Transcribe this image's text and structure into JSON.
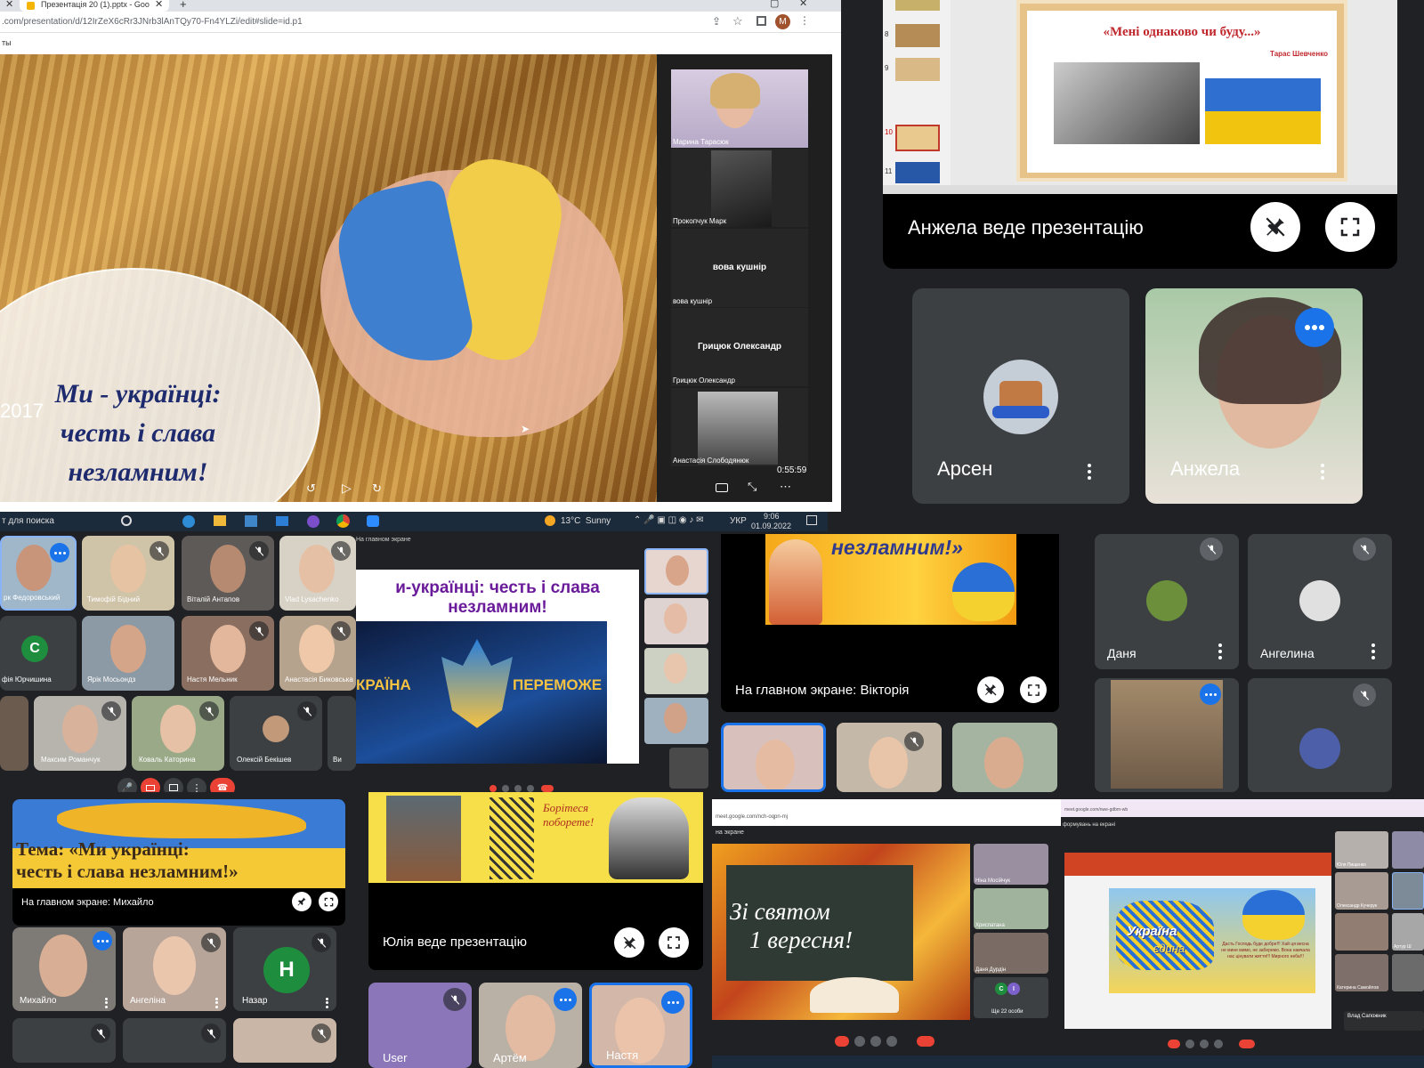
{
  "browser": {
    "tab_title": "Презентація 20 (1).pptx - Goo",
    "url": ".com/presentation/d/12IrZeX6cRr3JNrb3lAnTQy70-Fn4YLZi/edit#slide=id.p1",
    "bookmark": "ты",
    "profile_initial": "M"
  },
  "slide_main": {
    "title_line1": "Ми - українці:",
    "title_line2": "честь і слава",
    "title_line3": "незламним!",
    "year": "2017",
    "video_time": "0:55:59"
  },
  "side_participants": [
    {
      "name": "Марина Тарасюк"
    },
    {
      "name": "Прокопчук Марк"
    },
    {
      "name": "вова кушнір",
      "center": "вова кушнір"
    },
    {
      "name": "Грицюк Олександр",
      "center": "Грицюк Олександр"
    },
    {
      "name": "Анастасія Слободянюк"
    }
  ],
  "taskbar": {
    "search": "т для поиска",
    "weather": "13°C  Sunny",
    "lang": "УКР",
    "time": "9:06",
    "date": "01.09.2022"
  },
  "top_right": {
    "slide_title": "«Мені однаково чи буду...»",
    "slide_author": "Тарас Шевченко",
    "slide_numbers": [
      "8",
      "9",
      "10",
      "11"
    ],
    "presenting": "Анжела веде презентацію",
    "participants": [
      {
        "name": "Арсен"
      },
      {
        "name": "Анжела"
      }
    ]
  },
  "grid_mid_left": {
    "participants": [
      "рк Федоровський",
      "Тимофій Бідний",
      "Віталій Антапов",
      "Vlad Lysachenko",
      "фія Юрчишина",
      "Ярік Мосьондз",
      "Настя Мельник",
      "Анастасія Биковська",
      "Максим Романчук",
      "Коваль Каторина",
      "Олексій Бекішев",
      "Ви"
    ],
    "avatar_letter": "C"
  },
  "slide_center": {
    "title_line1": "и-українці: честь і слава",
    "title_line2": "незламним!",
    "banner_left": "КРАЇНА",
    "banner_right": "ПЕРЕМОЖЕ",
    "header": "На главном экране"
  },
  "mid_right": {
    "slide_text": "незламним!»",
    "main_screen": "На главном экране: Вікторія",
    "participants": [
      {
        "name": "Даня"
      },
      {
        "name": "Ангелина"
      }
    ]
  },
  "bottom_left": {
    "slide_title_line1": "Тема: «Ми українці:",
    "slide_title_line2": "честь і слава незламним!»",
    "main_screen": "На главном экране: Михайло",
    "participants": [
      {
        "name": "Михайло"
      },
      {
        "name": "Ангеліна"
      },
      {
        "name": "Назар",
        "letter": "Н"
      }
    ]
  },
  "bottom_center": {
    "slide_text": "Борітеся поборете!",
    "presenting": "Юлія веде презентацію",
    "participants": [
      {
        "name": "User"
      },
      {
        "name": "Артём"
      },
      {
        "name": "Настя"
      }
    ]
  },
  "bottom_right_a": {
    "url": "meet.google.com/nch-oqpn-mj",
    "header": "на экране",
    "slide_line1": "Зі святом",
    "slide_line2": "1 вересня!",
    "more": "Ще 22 особи",
    "side_names": [
      "Ніна Мосійчук",
      "Хриспатана",
      "Даня Дурдін"
    ]
  },
  "bottom_right_b": {
    "url": "meet.google.com/nwe-gdbm-wb",
    "header": "формувань на екрані",
    "slide_word1": "Україна",
    "slide_word2": "єдина",
    "slide_poem": "Дасть Господь буде добре!!! Хай ця весна не мине мимо, не заберемо. Вона навчала нас цінувати життя!!! Мирного неба!!!",
    "notification": "Влад Сапожник",
    "side_names": [
      "Юля Пищенко",
      "Олександр Кучерук",
      "Артур Ш",
      "Катерина Самойлов"
    ]
  }
}
